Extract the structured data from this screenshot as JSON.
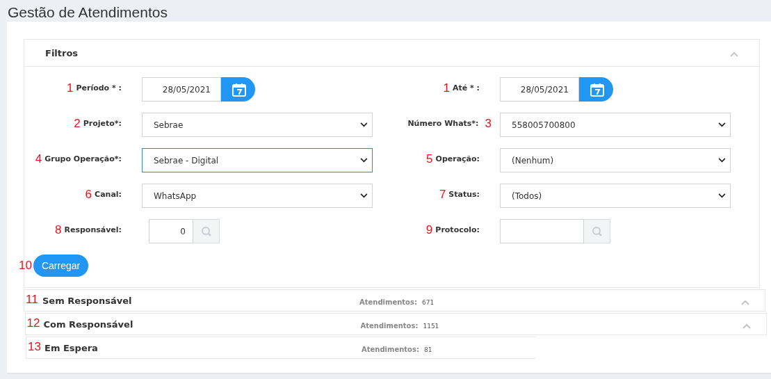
{
  "page_title": "Gestão de Atendimentos",
  "filters": {
    "title": "Filtros",
    "collapse_icon": true,
    "fields": [
      {
        "kind": "date",
        "marker": "1",
        "marker_after": false,
        "label": "Período * :",
        "value": "28/05/2021"
      },
      {
        "kind": "date",
        "marker": "1",
        "marker_after": false,
        "label": "Até * :",
        "value": "28/05/2021"
      },
      {
        "kind": "select",
        "marker": "2",
        "marker_after": false,
        "label": "Projeto*:",
        "value": "Sebrae",
        "focused": false
      },
      {
        "kind": "select",
        "marker": "3",
        "marker_after": true,
        "label": "Número Whats*:",
        "value": "558005700800",
        "focused": false
      },
      {
        "kind": "select",
        "marker": "4",
        "marker_after": false,
        "label": "Grupo Operação*:",
        "value": "Sebrae - Digital",
        "focused": true
      },
      {
        "kind": "select",
        "marker": "5",
        "marker_after": false,
        "label": "Operação:",
        "value": "(Nenhum)",
        "focused": false
      },
      {
        "kind": "select",
        "marker": "6",
        "marker_after": false,
        "label": "Canal:",
        "value": "WhatsApp",
        "focused": false
      },
      {
        "kind": "select",
        "marker": "7",
        "marker_after": false,
        "label": "Status:",
        "value": "(Todos)",
        "focused": false
      },
      {
        "kind": "lookup",
        "marker": "8",
        "marker_after": false,
        "label": "Responsável:",
        "value": "0"
      },
      {
        "kind": "lookup",
        "marker": "9",
        "marker_after": false,
        "label": "Protocolo:"
      }
    ],
    "load_button": {
      "marker": "10",
      "label": "Carregar"
    }
  },
  "panels": [
    {
      "marker": "11",
      "title": "Sem Responsável",
      "count_label": "Atendimentos:",
      "count": "671",
      "collapse_icon": true
    },
    {
      "marker": "12",
      "title": "Com Responsável",
      "count_label": "Atendimentos:",
      "count": "1151",
      "collapse_icon": true
    },
    {
      "marker": "13",
      "title": "Em Espera",
      "count_label": "Atendimentos:",
      "count": "81",
      "collapse_icon": false
    }
  ]
}
